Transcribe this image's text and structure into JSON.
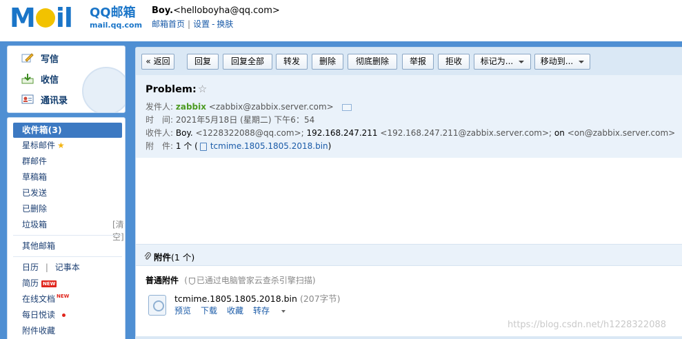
{
  "logo": {
    "brand": "MOil",
    "qq": "QQ邮箱",
    "url": "mail.qq.com"
  },
  "user": {
    "name": "Boy.",
    "email": "<helloboyha@qq.com>",
    "links": {
      "home": "邮箱首页",
      "settings": "设置",
      "switch": "换肤",
      "dash": "-",
      "sep": "|"
    }
  },
  "sidebar": {
    "actions": {
      "compose": "写信",
      "receive": "收信",
      "contacts": "通讯录"
    },
    "folders": {
      "inbox": "收件箱(3)",
      "starred": "星标邮件",
      "group": "群邮件",
      "drafts": "草稿箱",
      "sent": "已发送",
      "deleted": "已删除",
      "spam": "垃圾箱",
      "spam_clear": "[清空]",
      "other": "其他邮箱",
      "calendar": "日历",
      "cal_sep": "|",
      "notes": "记事本",
      "resume": "简历",
      "docs": "在线文档",
      "daily": "每日悦读",
      "attachments": "附件收藏",
      "new_badge": "NEW"
    }
  },
  "toolbar": {
    "back": "« 返回",
    "reply": "回复",
    "reply_all": "回复全部",
    "forward": "转发",
    "delete": "删除",
    "delete_perm": "彻底删除",
    "report": "举报",
    "reject": "拒收",
    "mark_as": "标记为...",
    "move_to": "移动到..."
  },
  "message": {
    "subject": "Problem:",
    "star": "☆",
    "from_label": "发件人:",
    "from_name": "zabbix",
    "from_email": "<zabbix@zabbix.server.com>",
    "time_label": "时　间:",
    "time_value": "2021年5月18日 (星期二) 下午6：54",
    "to_label": "收件人:",
    "to_1_name": "Boy.",
    "to_1_email": "<1228322088@qq.com>;",
    "to_2_name": "192.168.247.211",
    "to_2_email": "<192.168.247.211@zabbix.server.com>;",
    "to_3_name": "on",
    "to_3_email": "<on@zabbix.server.com>",
    "att_label": "附　件:",
    "att_count": "1 个 (",
    "att_name": "tcmime.1805.1805.2018.bin",
    "att_close": ")"
  },
  "attachments": {
    "title": "附件",
    "count": "(1 个)",
    "type_label": "普通附件",
    "scan_text": "已通过电脑管家云查杀引擎扫描)",
    "scan_open": "(",
    "file_name": "tcmime.1805.1805.2018.bin",
    "file_size": "(207字节)",
    "actions": {
      "preview": "预览",
      "download": "下载",
      "collect": "收藏",
      "forward": "转存"
    }
  },
  "watermark": "https://blog.csdn.net/h1228322088",
  "colors": {
    "frame": "#4f8fd3",
    "toolbar": "#dae8f5",
    "accent": "#1a75c8",
    "sender": "#4c9b22",
    "selected": "#3c79c2"
  }
}
